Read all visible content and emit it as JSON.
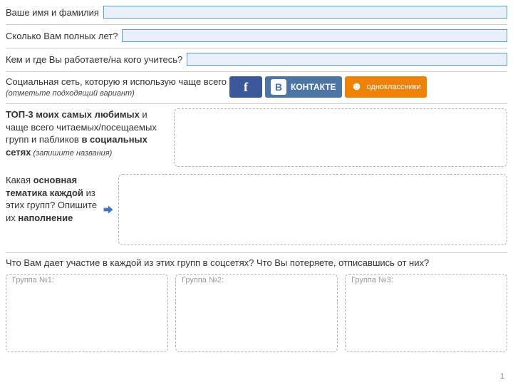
{
  "fields": {
    "name_label": "Ваше имя и фамилия",
    "age_label": "Сколько Вам полных лет?",
    "work_label": "Кем и где Вы работаете/на кого учитесь?"
  },
  "social": {
    "question": "Социальная сеть, которую я использую чаще всего",
    "hint": "(отметьте подходящий вариант)",
    "fb": "f",
    "vk_logo": "B",
    "vk_text": "КОНТАКТЕ",
    "ok_logo": "☻",
    "ok_text": "одноклассники"
  },
  "top3": {
    "label_html_parts": {
      "a": "ТОП-3 моих самых любимых",
      "b": " и чаще всего читаемых/посещаемых групп и пабликов ",
      "c": "в социальных сетях",
      "hint": " (запишите названия)"
    }
  },
  "topic": {
    "a": "Какая ",
    "b": "основная тематика каждой",
    "c": " из этих групп? Опишите их ",
    "d": "наполнение"
  },
  "question_full": "Что Вам дает участие в каждой из этих групп в соцсетях? Что Вы потеряете, отписавшись от них?",
  "groups": {
    "g1": "Группа №1:",
    "g2": "Группа №2:",
    "g3": "Группа №3:"
  },
  "page": "1"
}
